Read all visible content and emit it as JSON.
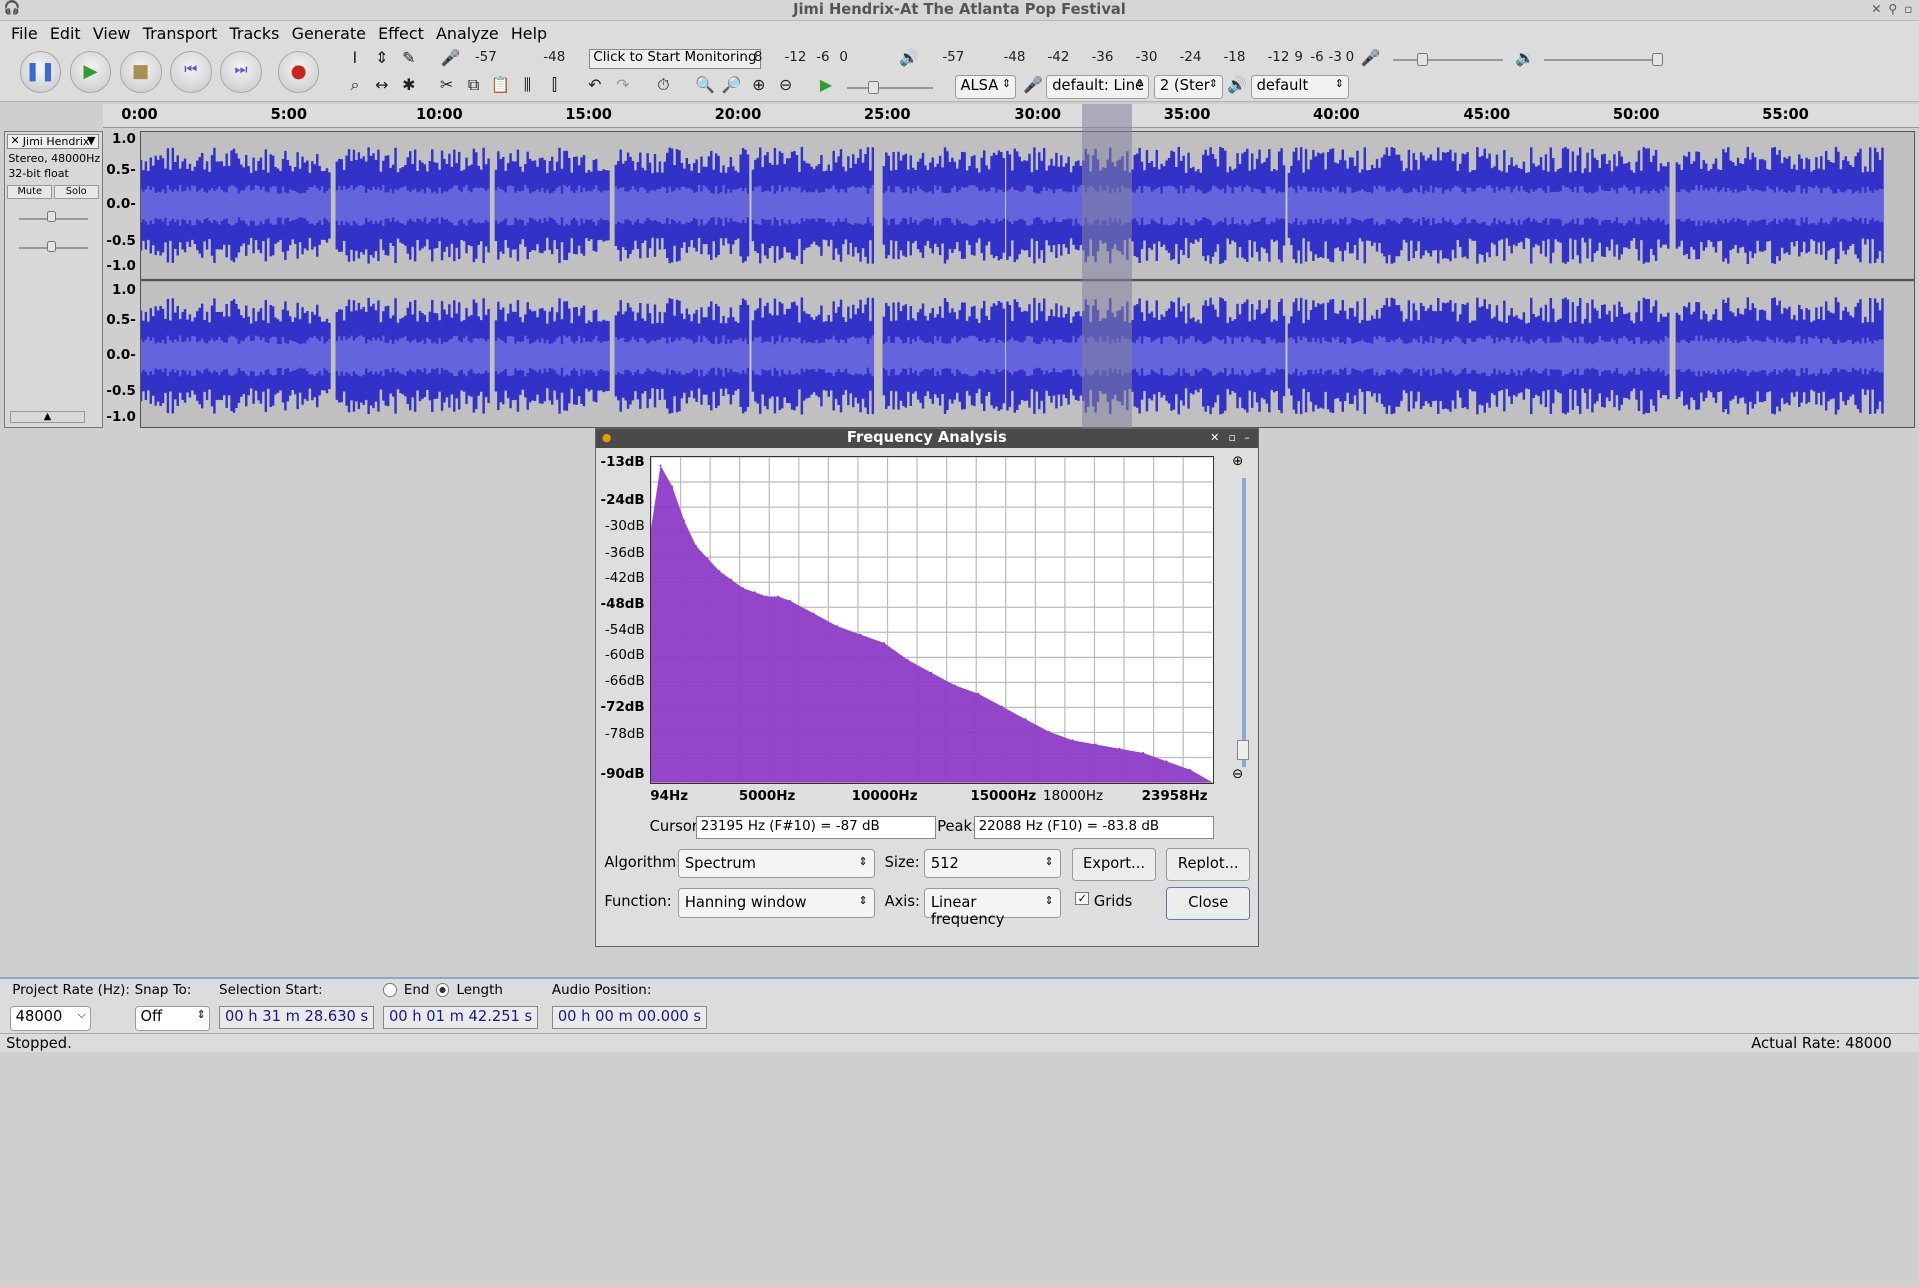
{
  "window": {
    "title": "Jimi Hendrix-At The Atlanta Pop Festival"
  },
  "menu": [
    "File",
    "Edit",
    "View",
    "Transport",
    "Tracks",
    "Generate",
    "Effect",
    "Analyze",
    "Help"
  ],
  "toolbar": {
    "record_meter_ticks": [
      "-57",
      "-48"
    ],
    "monitor_label": "Click to Start Monitoring",
    "record_meter_ticks_right": [
      "8",
      "-12",
      "9",
      "-6",
      "-3",
      "0"
    ],
    "play_meter_ticks": [
      "-57",
      "-48",
      "-42",
      "-36",
      "-30",
      "-24",
      "-18",
      "-12",
      "9",
      "-6",
      "-3",
      "0"
    ],
    "host": "ALSA",
    "recording_device": "default: Line",
    "channels": "2 (Ster",
    "playback_device": "default"
  },
  "ruler": [
    "0:00",
    "5:00",
    "10:00",
    "15:00",
    "20:00",
    "25:00",
    "30:00",
    "35:00",
    "40:00",
    "45:00",
    "50:00",
    "55:00"
  ],
  "track": {
    "name": "Jimi Hendrix",
    "info1": "Stereo, 48000Hz",
    "info2": "32-bit float",
    "mute": "Mute",
    "solo": "Solo",
    "scale": [
      "1.0",
      "0.5-",
      "0.0-",
      "-0.5",
      "-1.0"
    ]
  },
  "dialog": {
    "title": "Frequency Analysis",
    "y_labels": [
      "-13dB",
      "-24dB",
      "-30dB",
      "-36dB",
      "-42dB",
      "-48dB",
      "-54dB",
      "-60dB",
      "-66dB",
      "-72dB",
      "-78dB",
      "-90dB"
    ],
    "x_labels": [
      "94Hz",
      "5000Hz",
      "10000Hz",
      "15000Hz",
      "18000Hz",
      "23958Hz"
    ],
    "cursor_label": "Cursor:",
    "cursor_value": "23195 Hz (F#10) = -87 dB",
    "peak_label": "Peak:",
    "peak_value": "22088 Hz (F10) = -83.8 dB",
    "algorithm_label": "Algorithm:",
    "algorithm": "Spectrum",
    "size_label": "Size:",
    "size": "512",
    "export": "Export...",
    "replot": "Replot...",
    "function_label": "Function:",
    "function": "Hanning window",
    "axis_label": "Axis:",
    "axis": "Linear frequency",
    "grids": "Grids",
    "close": "Close"
  },
  "bottom": {
    "project_rate_label": "Project Rate (Hz):",
    "project_rate": "48000",
    "snap_label": "Snap To:",
    "snap": "Off",
    "selection_start_label": "Selection Start:",
    "end_label": "End",
    "length_label": "Length",
    "audio_position_label": "Audio Position:",
    "selection_start": "00 h 31 m 28.630 s",
    "length": "00 h 01 m 42.251 s",
    "audio_position": "00 h 00 m 00.000 s"
  },
  "status": {
    "left": "Stopped.",
    "right": "Actual Rate: 48000"
  },
  "chart_data": {
    "type": "area",
    "x": [
      94,
      500,
      1000,
      1500,
      2000,
      2500,
      3000,
      3500,
      4000,
      4500,
      5000,
      5500,
      6000,
      7000,
      8000,
      9000,
      10000,
      11000,
      12000,
      13000,
      14000,
      15000,
      16000,
      17000,
      18000,
      19000,
      20000,
      21000,
      22000,
      23000,
      23958
    ],
    "values": [
      -30,
      -15,
      -20,
      -28,
      -34,
      -37,
      -40,
      -42,
      -44,
      -45,
      -46,
      -46,
      -47,
      -50,
      -53,
      -55,
      -57,
      -61,
      -64,
      -67,
      -69,
      -72,
      -75,
      -78,
      -80,
      -81,
      -82,
      -83,
      -85,
      -87,
      -90
    ],
    "ylim": [
      -90,
      -13
    ],
    "xlim": [
      94,
      23958
    ],
    "grid": true,
    "color": "#8e3cc8"
  }
}
